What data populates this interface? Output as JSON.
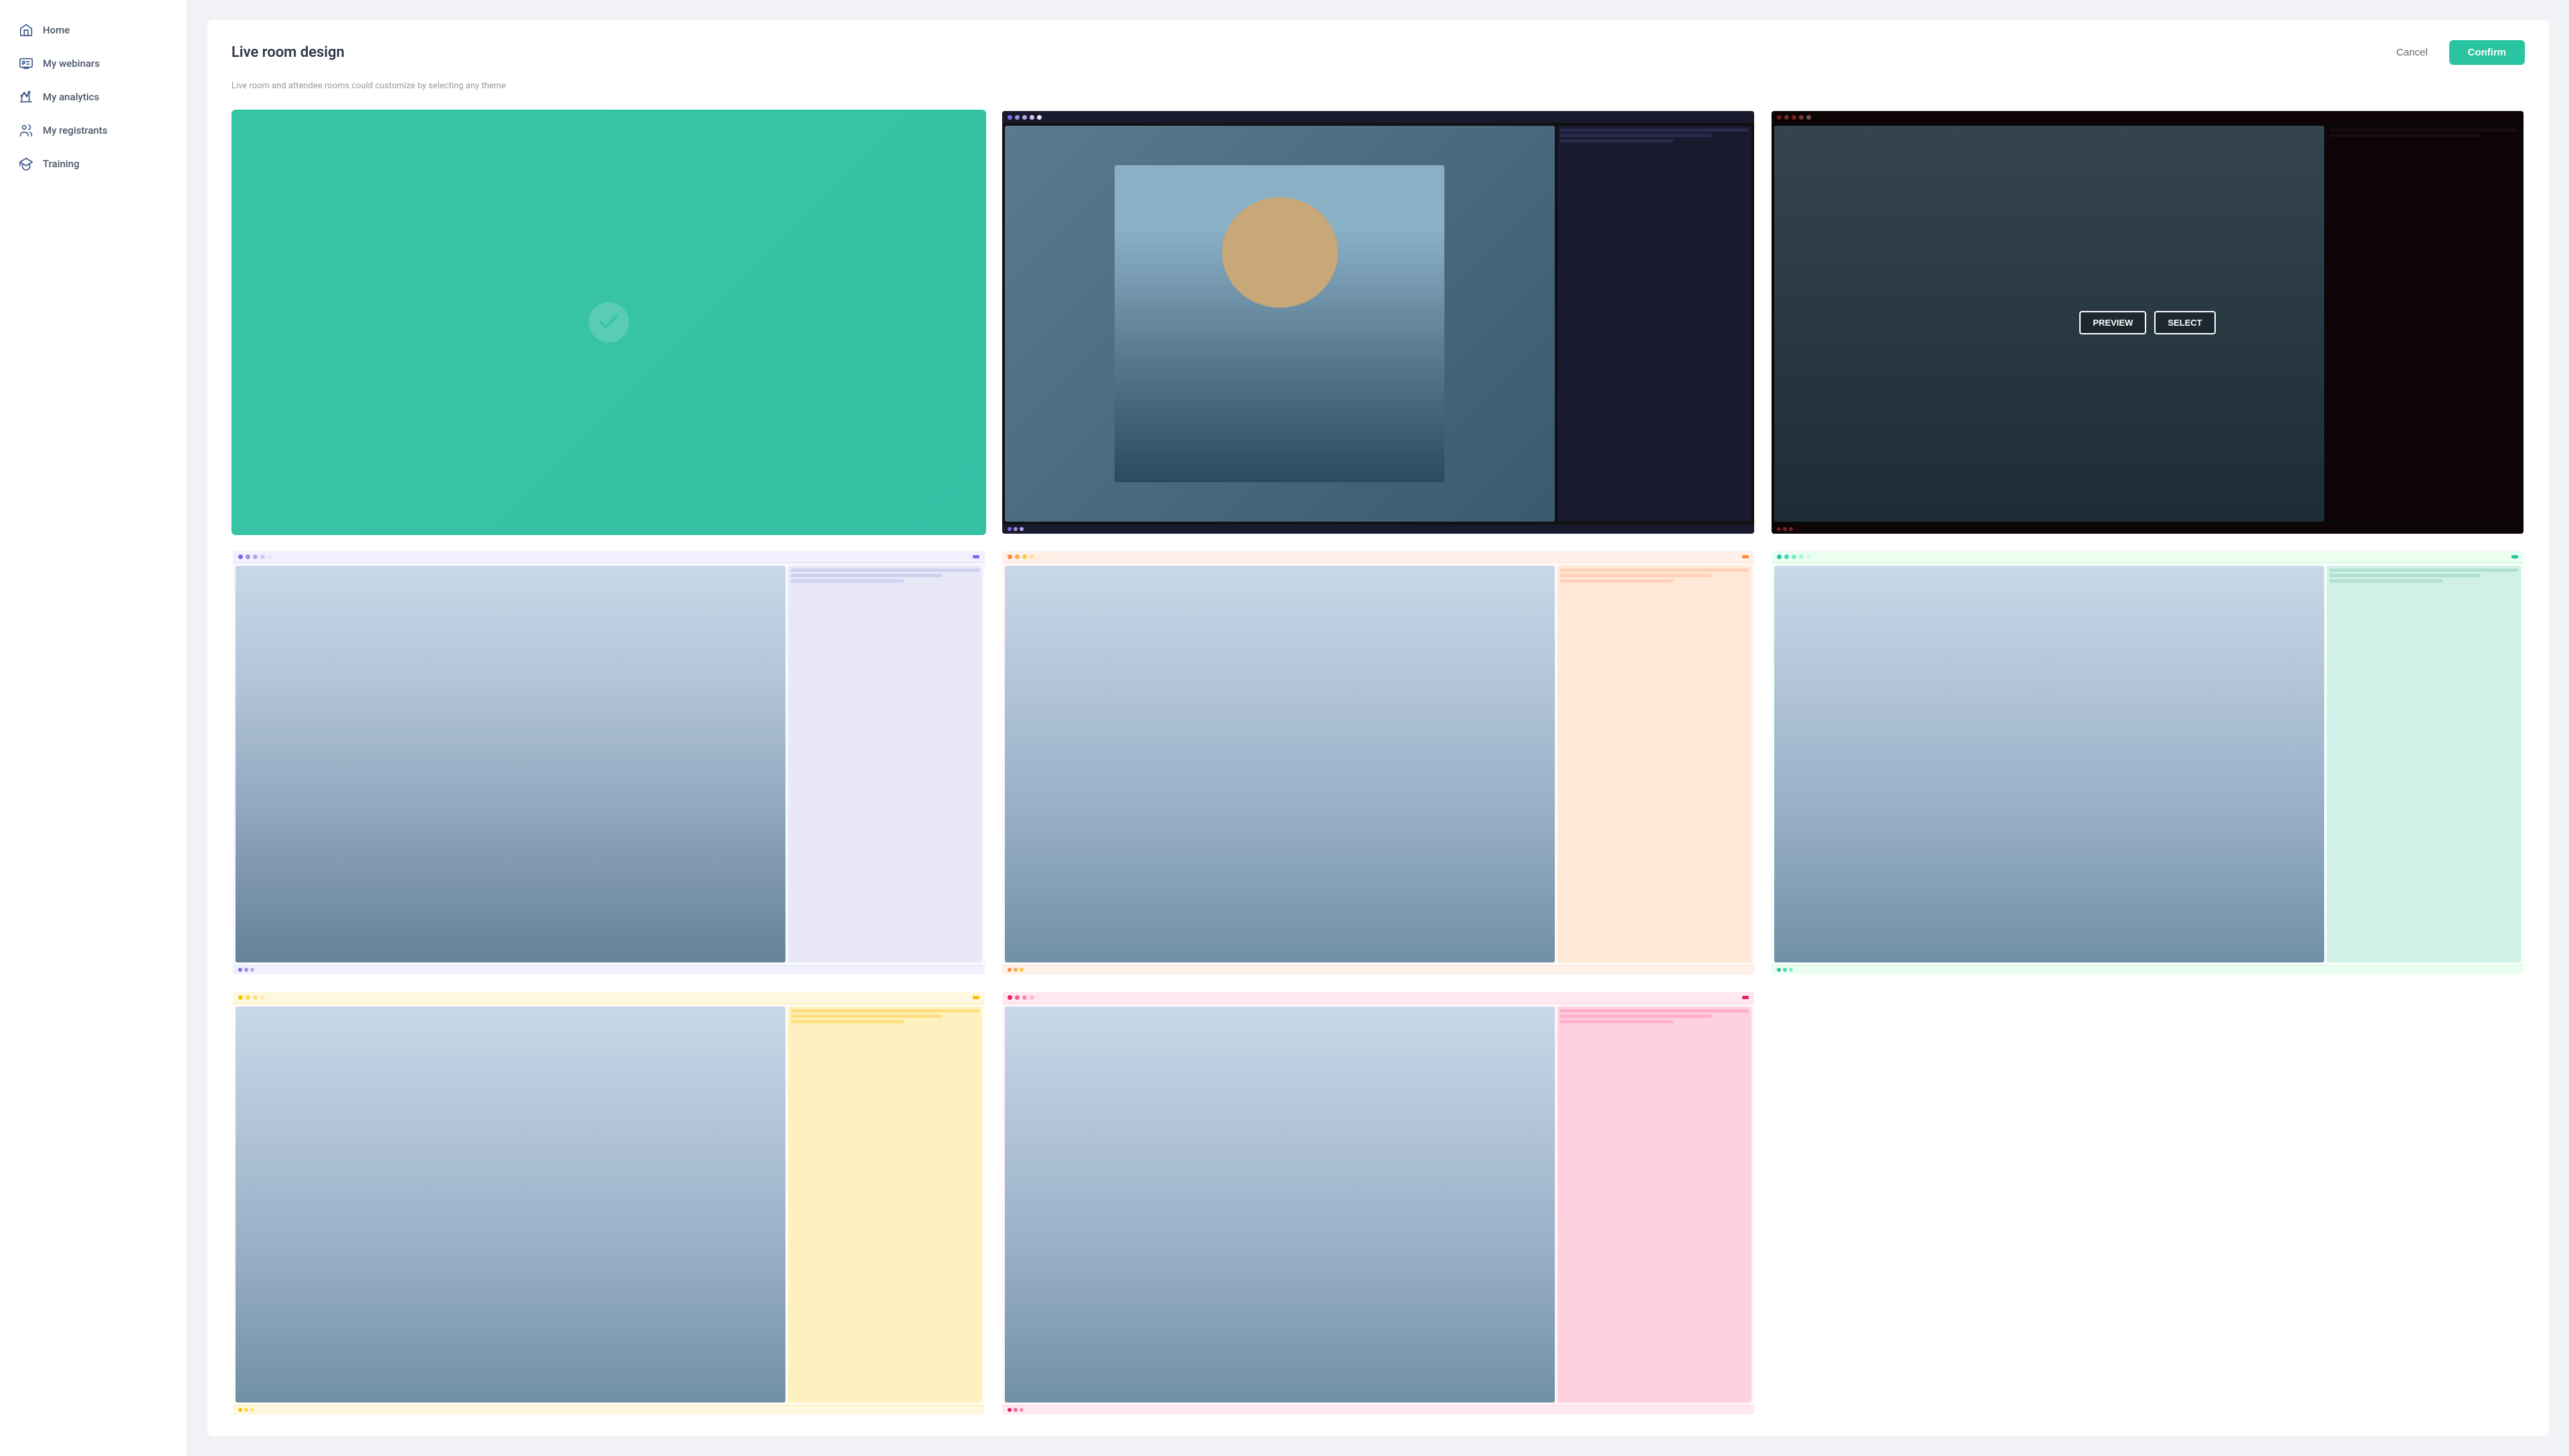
{
  "sidebar": {
    "items": [
      {
        "id": "home",
        "label": "Home",
        "icon": "home"
      },
      {
        "id": "my-webinars",
        "label": "My webinars",
        "icon": "webinars"
      },
      {
        "id": "my-analytics",
        "label": "My analytics",
        "icon": "analytics"
      },
      {
        "id": "my-registrants",
        "label": "My registrants",
        "icon": "registrants"
      },
      {
        "id": "training",
        "label": "Training",
        "icon": "training"
      }
    ]
  },
  "page": {
    "title": "Live room design",
    "subtitle": "Live room and attendee rooms could customize by selecting any theme",
    "cancel_label": "Cancel",
    "confirm_label": "Confirm"
  },
  "themes": [
    {
      "id": "theme-1",
      "type": "selected-teal",
      "selected": true
    },
    {
      "id": "theme-2",
      "type": "dark",
      "selected": false
    },
    {
      "id": "theme-3",
      "type": "dark-hover",
      "selected": false,
      "show_overlay": true
    },
    {
      "id": "theme-4",
      "type": "light-purple",
      "selected": false
    },
    {
      "id": "theme-5",
      "type": "light-peach",
      "selected": false
    },
    {
      "id": "theme-6",
      "type": "light-green",
      "selected": false
    },
    {
      "id": "theme-7",
      "type": "light-yellow",
      "selected": false
    },
    {
      "id": "theme-8",
      "type": "light-pink",
      "selected": false
    }
  ],
  "overlay": {
    "preview_label": "PREVIEW",
    "select_label": "SELECT"
  },
  "dots": {
    "purple": [
      "#7b68ee",
      "#9b8ee0",
      "#b8a8e0",
      "#d0c8f0",
      "#e8e4f8"
    ],
    "orange": [
      "#ff8c42",
      "#ffaa42",
      "#ffc842",
      "#ffe0a0",
      "#fff0d0"
    ],
    "green": [
      "#2ac4a0",
      "#4dd4b0",
      "#80e8d0",
      "#b0f0e0",
      "#d0f8f0"
    ],
    "yellow": [
      "#ffc107",
      "#ffd54f",
      "#ffe082",
      "#ffecb3",
      "#fff8e1"
    ],
    "pink": [
      "#e91e63",
      "#f06292",
      "#f48fb1",
      "#f8bbd0",
      "#fce4ec"
    ]
  }
}
